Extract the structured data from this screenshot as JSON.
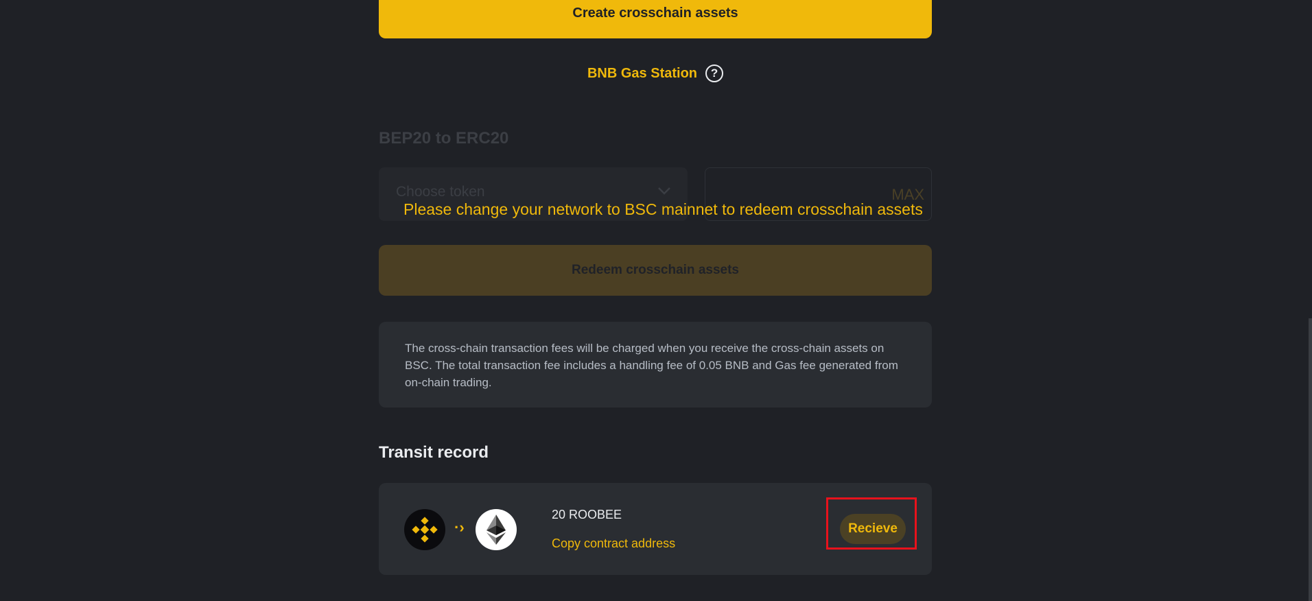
{
  "create_button": {
    "label": "Create crosschain assets"
  },
  "gas_station": {
    "label": "BNB Gas Station",
    "help_glyph": "?"
  },
  "redeem_form": {
    "direction_title": "BEP20 to ERC20",
    "token_placeholder": "Choose token",
    "max_label": "MAX",
    "network_warning": "Please change your network to BSC mainnet to redeem crosschain assets",
    "redeem_label": "Redeem crosschain assets"
  },
  "fee_notice": {
    "text": "The cross-chain transaction fees will be charged when you receive the cross-chain assets on BSC. The total transaction fee includes a handling fee of 0.05 BNB and Gas fee generated from on-chain trading."
  },
  "transit_record": {
    "title": "Transit record",
    "records": [
      {
        "from_icon": "bnb-chain-icon",
        "to_icon": "ethereum-icon",
        "amount": "20 ROOBEE",
        "copy_label": "Copy contract address",
        "action_label": "Recieve"
      }
    ]
  },
  "colors": {
    "accent": "#f0b90b",
    "background": "#1f2126",
    "card": "#2a2d32",
    "highlight": "#e8121c"
  }
}
